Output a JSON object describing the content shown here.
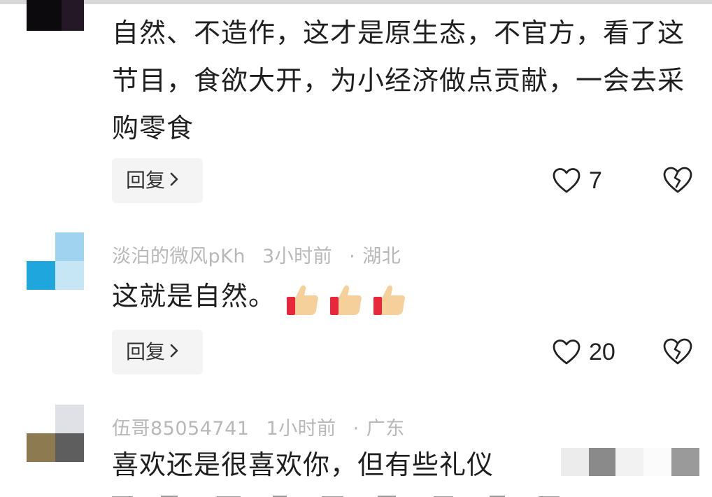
{
  "comments": [
    {
      "text": "自然、不造作，这才是原生态，不官方，看了这节目，食欲大开，为小经济做点贡献，一会去采购零食",
      "reply_label": "回复",
      "likes": "7"
    },
    {
      "username": "淡泊的微风pKh",
      "time": "3小时前",
      "location": "湖北",
      "text": "这就是自然。",
      "reply_label": "回复",
      "likes": "20"
    },
    {
      "username": "伍哥85054741",
      "time": "1小时前",
      "location": "广东",
      "text": "喜欢还是很喜欢你，但有些礼仪"
    }
  ],
  "meta_separator": "·",
  "icons": {
    "like": "heart-outline-icon",
    "dislike": "broken-heart-icon",
    "reply_chevron": "chevron-right-icon",
    "emoji": "thumbs-up-emoji"
  },
  "colors": {
    "meta_text": "#b8b8b8",
    "reply_bg": "#f4f4f4",
    "avatar2_cyan": "#1fa6dc",
    "avatar2_light": "#9fd3ef"
  }
}
